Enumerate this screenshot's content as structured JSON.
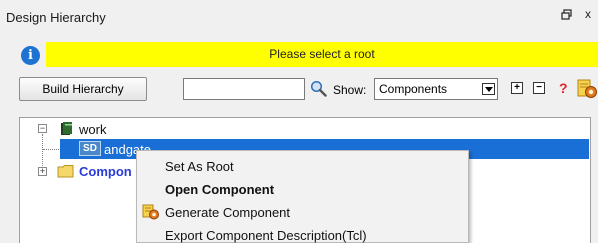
{
  "panel": {
    "title": "Design Hierarchy",
    "float_icon": "float-window-icon",
    "close_icon": "close-icon",
    "close_glyph": "x"
  },
  "banner": {
    "info_icon": "info-icon",
    "info_glyph": "i",
    "message": "Please select a root",
    "color": "#ffff00"
  },
  "toolbar": {
    "build_label": "Build Hierarchy",
    "search_value": "",
    "search_icon": "search-icon",
    "show_label": "Show:",
    "show_value": "Components",
    "expand_glyph": "+",
    "collapse_glyph": "−",
    "help_glyph": "?",
    "generate_icon": "generate-component-icon"
  },
  "tree": {
    "root": {
      "label": "work",
      "icon": "library-icon",
      "expander": "−"
    },
    "child": {
      "label": "andgate",
      "badge": "SD",
      "selected": true
    },
    "folder": {
      "label": "Compon",
      "icon": "folder-icon",
      "expander": "+"
    },
    "selection_color": "#1a6fd6"
  },
  "context_menu": {
    "items": [
      {
        "label": "Set As Root",
        "bold": false,
        "icon": ""
      },
      {
        "label": "Open Component",
        "bold": true,
        "icon": ""
      },
      {
        "label": "Generate Component",
        "bold": false,
        "icon": "generate-component-icon"
      },
      {
        "label": "Export Component Description(Tcl)",
        "bold": false,
        "icon": ""
      }
    ]
  }
}
